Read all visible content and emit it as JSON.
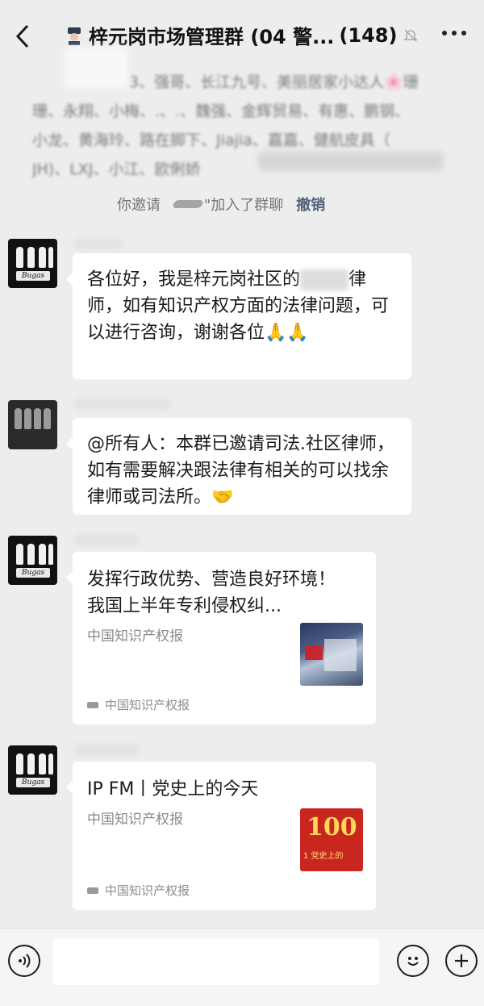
{
  "header": {
    "title": "梓元岗市场管理群 (04 警...",
    "count": "(148)"
  },
  "members": {
    "lines": [
      "3、强哥、长江九号、美丽居家小达人🌸珊",
      "珊、永翔、小梅、.、.、魏强、金辉贸易、有惠、鹏钢、",
      "小龙、黄海玲、路在脚下、Jiajia、嘉嘉、健航皮具（",
      "JH)、LXJ、小江、欧俐娇"
    ]
  },
  "notice": {
    "you_invited": "你邀请",
    "joined": "\"加入了群聊",
    "undo": "撤销"
  },
  "messages": [
    {
      "text_a": "各位好，我是梓元岗社区的",
      "text_b": "律师，如有知识产权方面的法律问题，可以进行咨询，谢谢各位",
      "emoji": "🙏🙏"
    },
    {
      "text": "@所有人：本群已邀请司法.社区律师，如有需要解决跟法律有相关的可以找余律师或司法所。",
      "emoji": "🤝"
    }
  ],
  "cards": [
    {
      "title": "发挥行政优势、营造良好环境！我国上半年专利侵权纠...",
      "source": "中国知识产权报",
      "footer": "中国知识产权报"
    },
    {
      "title": "IP FM丨党史上的今天",
      "source": "中国知识产权报",
      "footer": "中国知识产权报",
      "thumb_text": "100",
      "thumb_sub": "1 党史上的"
    }
  ],
  "avatar_label": "Bugas",
  "colors": {
    "background": "#ededed",
    "bubble": "#ffffff",
    "link": "#52607a"
  }
}
